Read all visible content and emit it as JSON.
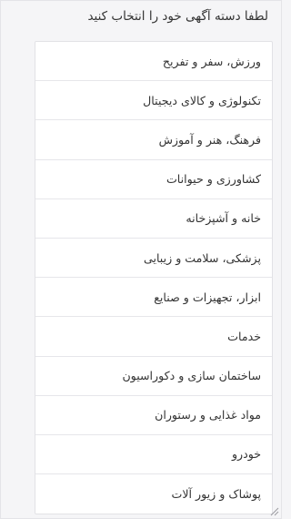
{
  "title": "لطفا دسته آگهی خود را انتخاب کنید",
  "categories": [
    {
      "label": "ورزش، سفر و تفریح"
    },
    {
      "label": "تکنولوژی و کالای دیجیتال"
    },
    {
      "label": "فرهنگ، هنر و آموزش"
    },
    {
      "label": "کشاورزی و حیوانات"
    },
    {
      "label": "خانه و آشپزخانه"
    },
    {
      "label": "پزشکی، سلامت و زیبایی"
    },
    {
      "label": "ابزار، تجهیزات و صنایع"
    },
    {
      "label": "خدمات"
    },
    {
      "label": "ساختمان سازی و دکوراسیون"
    },
    {
      "label": "مواد غذایی و رستوران"
    },
    {
      "label": "خودرو"
    },
    {
      "label": "پوشاک و زیور آلات"
    }
  ],
  "colors": {
    "background": "#f5f5f7",
    "list_background": "#ffffff",
    "text": "#333333",
    "border": "#e6e6ea"
  },
  "icons": {
    "watermark": "watermark-logo-icon",
    "resize": "resize-grip-icon"
  }
}
